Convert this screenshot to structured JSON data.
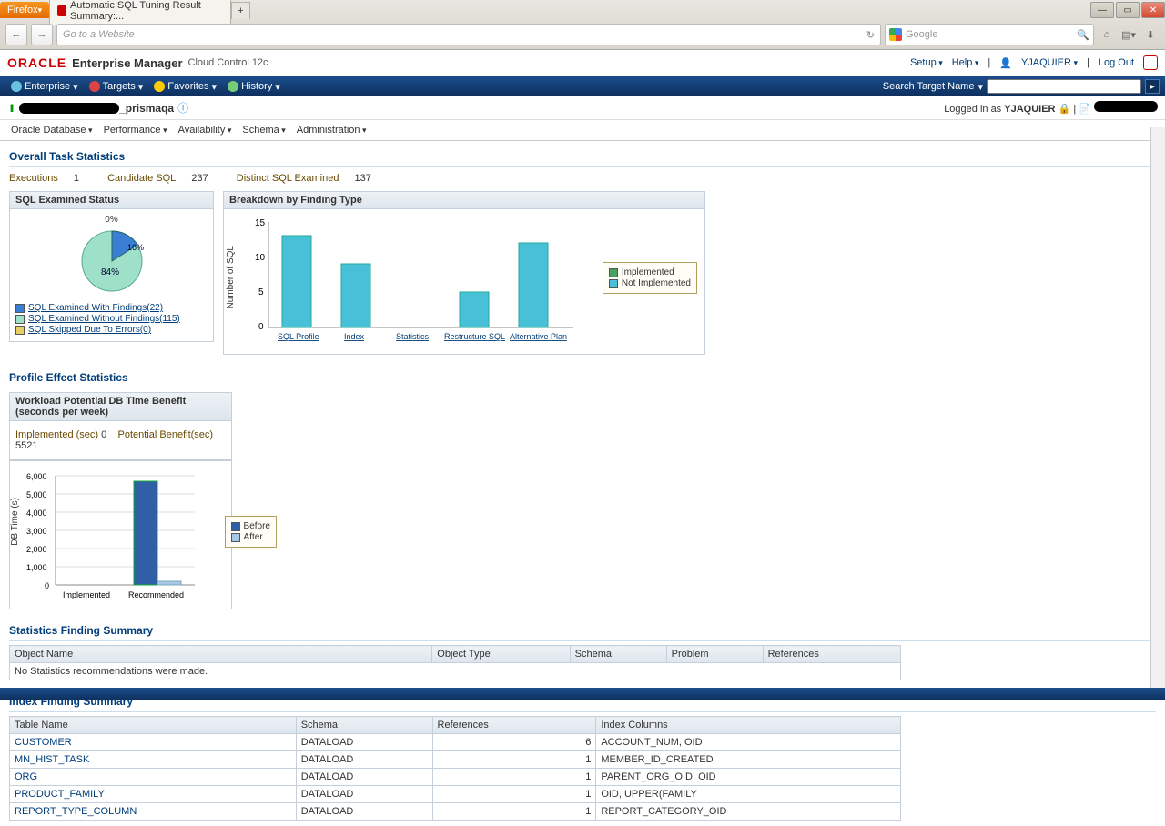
{
  "browser": {
    "firefox_btn": "Firefox",
    "tab_title": "Automatic SQL Tuning Result Summary:...",
    "url_placeholder": "Go to a Website",
    "search_placeholder": "Google"
  },
  "oracle": {
    "logo": "ORACLE",
    "product": "Enterprise Manager",
    "edition": "Cloud Control 12c",
    "links": {
      "setup": "Setup",
      "help": "Help",
      "user": "YJAQUIER",
      "logout": "Log Out"
    }
  },
  "mainnav": {
    "enterprise": "Enterprise",
    "targets": "Targets",
    "favorites": "Favorites",
    "history": "History",
    "search_label": "Search Target Name"
  },
  "target": {
    "name_suffix": "_prismaqa",
    "logged_in_label": "Logged in as",
    "logged_in_user": "YJAQUIER"
  },
  "subnav": {
    "db": "Oracle Database",
    "perf": "Performance",
    "avail": "Availability",
    "schema": "Schema",
    "admin": "Administration"
  },
  "overall": {
    "title": "Overall Task Statistics",
    "exec_label": "Executions",
    "exec_val": "1",
    "cand_label": "Candidate SQL",
    "cand_val": "237",
    "dist_label": "Distinct SQL Examined",
    "dist_val": "137"
  },
  "examined": {
    "title": "SQL Examined Status",
    "pie_labels": {
      "top": "0%",
      "right": "16%",
      "center": "84%"
    },
    "legend": {
      "with": "SQL Examined With Findings(22)",
      "without": "SQL Examined Without Findings(115)",
      "skipped": "SQL Skipped Due To Errors(0)"
    }
  },
  "breakdown": {
    "title": "Breakdown by Finding Type",
    "ylabel": "Number of SQL",
    "legend": {
      "impl": "Implemented",
      "notimpl": "Not Implemented"
    }
  },
  "profile": {
    "title": "Profile Effect Statistics",
    "workload_title": "Workload Potential DB Time Benefit (seconds per week)",
    "impl_label": "Implemented (sec)",
    "impl_val": "0",
    "pot_label": "Potential Benefit(sec)",
    "pot_val": "5521",
    "ylabel": "DB Time (s)",
    "legend": {
      "before": "Before",
      "after": "After"
    }
  },
  "statfind": {
    "title": "Statistics Finding Summary",
    "cols": {
      "obj": "Object Name",
      "type": "Object Type",
      "schema": "Schema",
      "problem": "Problem",
      "refs": "References"
    },
    "empty": "No Statistics recommendations were made."
  },
  "idxfind": {
    "title": "Index Finding Summary",
    "cols": {
      "tbl": "Table Name",
      "schema": "Schema",
      "refs": "References",
      "idx": "Index Columns"
    },
    "rows": [
      {
        "tbl": "CUSTOMER",
        "schema": "DATALOAD",
        "refs": "6",
        "idx": "ACCOUNT_NUM, OID"
      },
      {
        "tbl": "MN_HIST_TASK",
        "schema": "DATALOAD",
        "refs": "1",
        "idx": "MEMBER_ID_CREATED"
      },
      {
        "tbl": "ORG",
        "schema": "DATALOAD",
        "refs": "1",
        "idx": "PARENT_ORG_OID, OID"
      },
      {
        "tbl": "PRODUCT_FAMILY",
        "schema": "DATALOAD",
        "refs": "1",
        "idx": "OID, UPPER(FAMILY"
      },
      {
        "tbl": "REPORT_TYPE_COLUMN",
        "schema": "DATALOAD",
        "refs": "1",
        "idx": "REPORT_CATEGORY_OID"
      }
    ]
  },
  "chart_data": [
    {
      "type": "pie",
      "title": "SQL Examined Status",
      "slices": [
        {
          "name": "SQL Examined With Findings",
          "value": 22,
          "pct": 16
        },
        {
          "name": "SQL Examined Without Findings",
          "value": 115,
          "pct": 84
        },
        {
          "name": "SQL Skipped Due To Errors",
          "value": 0,
          "pct": 0
        }
      ]
    },
    {
      "type": "bar",
      "title": "Breakdown by Finding Type",
      "ylabel": "Number of SQL",
      "ylim": [
        0,
        15
      ],
      "categories": [
        "SQL Profile",
        "Index",
        "Statistics",
        "Restructure SQL",
        "Alternative Plan"
      ],
      "series": [
        {
          "name": "Implemented",
          "values": [
            0,
            0,
            0,
            0,
            0
          ]
        },
        {
          "name": "Not Implemented",
          "values": [
            13,
            9,
            0,
            5,
            12
          ]
        }
      ]
    },
    {
      "type": "bar",
      "title": "Workload Potential DB Time Benefit (seconds per week)",
      "ylabel": "DB Time (s)",
      "ylim": [
        0,
        6000
      ],
      "categories": [
        "Implemented",
        "Recommended"
      ],
      "series": [
        {
          "name": "Before",
          "values": [
            0,
            5700
          ]
        },
        {
          "name": "After",
          "values": [
            0,
            180
          ]
        }
      ]
    }
  ]
}
